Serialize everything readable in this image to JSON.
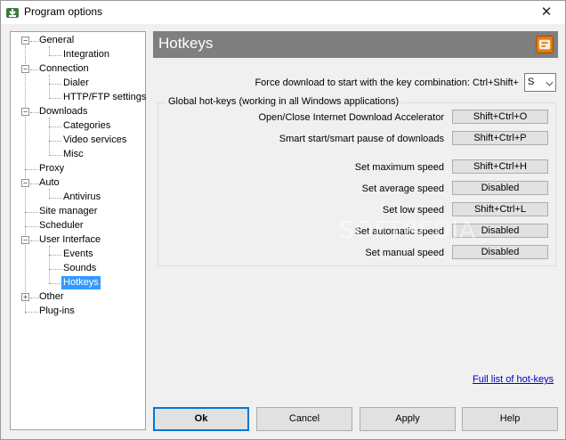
{
  "window": {
    "title": "Program options",
    "close_glyph": "✕"
  },
  "tree": {
    "items": [
      {
        "label": "General"
      },
      {
        "label": "Integration"
      },
      {
        "label": "Connection"
      },
      {
        "label": "Dialer"
      },
      {
        "label": "HTTP/FTP settings"
      },
      {
        "label": "Downloads"
      },
      {
        "label": "Categories"
      },
      {
        "label": "Video services"
      },
      {
        "label": "Misc"
      },
      {
        "label": "Proxy"
      },
      {
        "label": "Auto"
      },
      {
        "label": "Antivirus"
      },
      {
        "label": "Site manager"
      },
      {
        "label": "Scheduler"
      },
      {
        "label": "User Interface"
      },
      {
        "label": "Events"
      },
      {
        "label": "Sounds"
      },
      {
        "label": "Hotkeys"
      },
      {
        "label": "Other"
      },
      {
        "label": "Plug-ins"
      }
    ],
    "expanders": {
      "minus": "−",
      "plus": "+"
    }
  },
  "header": {
    "title": "Hotkeys"
  },
  "force_download": {
    "label": "Force download to start with the key combination: Ctrl+Shift+",
    "selected_key": "S"
  },
  "global_hotkeys": {
    "legend": "Global hot-keys (working in all Windows applications)",
    "rows": [
      {
        "label": "Open/Close Internet Download Accelerator",
        "value": "Shift+Ctrl+O"
      },
      {
        "label": "Smart start/smart pause of downloads",
        "value": "Shift+Ctrl+P"
      },
      {
        "label": "Set maximum speed",
        "value": "Shift+Ctrl+H"
      },
      {
        "label": "Set average speed",
        "value": "Disabled"
      },
      {
        "label": "Set low speed",
        "value": "Shift+Ctrl+L"
      },
      {
        "label": "Set automatic speed",
        "value": "Disabled"
      },
      {
        "label": "Set manual speed",
        "value": "Disabled"
      }
    ]
  },
  "link": {
    "label": "Full list of hot-keys"
  },
  "buttons": {
    "ok": "Ok",
    "cancel": "Cancel",
    "apply": "Apply",
    "help": "Help"
  },
  "watermark": "SOFTPEDIA"
}
